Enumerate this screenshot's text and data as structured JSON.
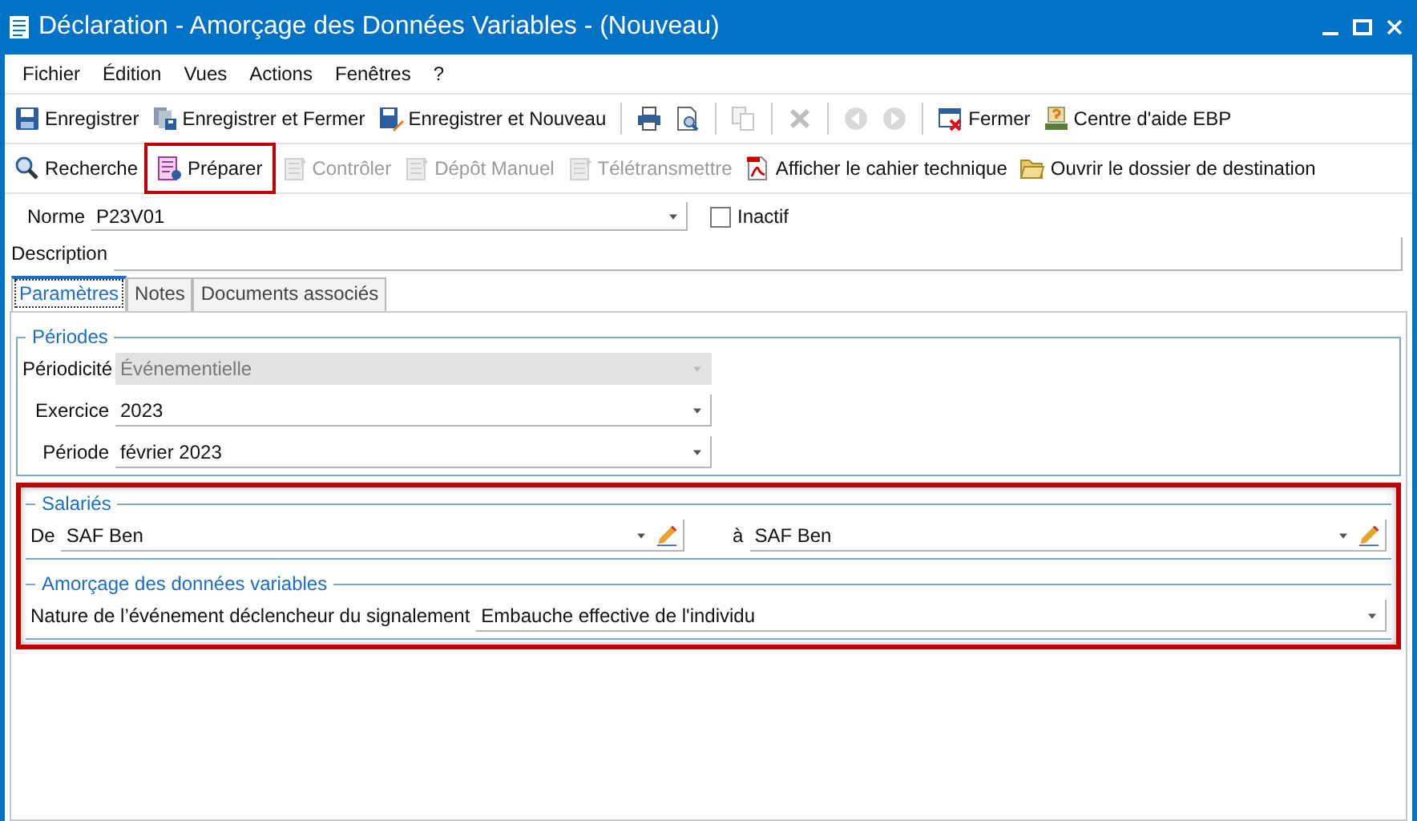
{
  "window": {
    "title": "Déclaration - Amorçage des Données Variables - (Nouveau)"
  },
  "menu": [
    "Fichier",
    "Édition",
    "Vues",
    "Actions",
    "Fenêtres",
    "?"
  ],
  "toolbar_1": [
    {
      "kind": "button",
      "label": "Enregistrer",
      "disabled": false
    },
    {
      "kind": "button",
      "label": "Enregistrer et Fermer",
      "disabled": false
    },
    {
      "kind": "button",
      "label": "Enregistrer et Nouveau",
      "disabled": false
    },
    {
      "kind": "separator"
    },
    {
      "kind": "icon",
      "disabled": false
    },
    {
      "kind": "icon",
      "disabled": false
    },
    {
      "kind": "separator"
    },
    {
      "kind": "icon",
      "disabled": true
    },
    {
      "kind": "separator"
    },
    {
      "kind": "icon",
      "disabled": true
    },
    {
      "kind": "separator"
    },
    {
      "kind": "icon",
      "disabled": true
    },
    {
      "kind": "icon",
      "disabled": true
    },
    {
      "kind": "separator"
    },
    {
      "kind": "button",
      "label": "Fermer",
      "disabled": false
    },
    {
      "kind": "button",
      "label": "Centre d'aide EBP",
      "disabled": false
    }
  ],
  "toolbar_2": [
    {
      "kind": "button",
      "label": "Recherche",
      "disabled": false,
      "highlighted": false
    },
    {
      "kind": "button",
      "label": "Préparer",
      "disabled": false,
      "highlighted": true
    },
    {
      "kind": "button",
      "label": "Contrôler",
      "disabled": true,
      "highlighted": false
    },
    {
      "kind": "button",
      "label": "Dépôt Manuel",
      "disabled": true,
      "highlighted": false
    },
    {
      "kind": "button",
      "label": "Télétransmettre",
      "disabled": true,
      "highlighted": false
    },
    {
      "kind": "button",
      "label": "Afficher le cahier technique",
      "disabled": false,
      "highlighted": false
    },
    {
      "kind": "button",
      "label": "Ouvrir le dossier de destination",
      "disabled": false,
      "highlighted": false
    }
  ],
  "norme": {
    "label": "Norme",
    "value": "P23V01"
  },
  "inactive": {
    "label": "Inactif",
    "checked": false
  },
  "description": {
    "label": "Description"
  },
  "tabs": [
    {
      "label": "Paramètres",
      "selected": true
    },
    {
      "label": "Notes",
      "selected": false
    },
    {
      "label": "Documents associés",
      "selected": false
    }
  ],
  "groups": [
    {
      "title": "Périodes",
      "kind": "stack",
      "fields": [
        {
          "label": "Périodicité",
          "value": "Événementielle",
          "disabled": true
        },
        {
          "label": "Exercice",
          "value": "2023",
          "disabled": false
        },
        {
          "label": "Période",
          "value": "février 2023",
          "disabled": false
        }
      ]
    },
    {
      "title": "Salariés",
      "kind": "row",
      "highlighted": true,
      "fields": [
        {
          "label": "De",
          "value": "SAF Ben",
          "disabled": false,
          "edit_button": true
        },
        {
          "label": "à",
          "value": "SAF Ben",
          "disabled": false,
          "edit_button": true
        }
      ]
    },
    {
      "title": "Amorçage des données variables",
      "kind": "row",
      "highlighted": true,
      "fields": [
        {
          "label": "Nature de l’événement déclencheur du signalement",
          "value": "Embauche effective de l'individu",
          "disabled": false
        }
      ]
    }
  ]
}
